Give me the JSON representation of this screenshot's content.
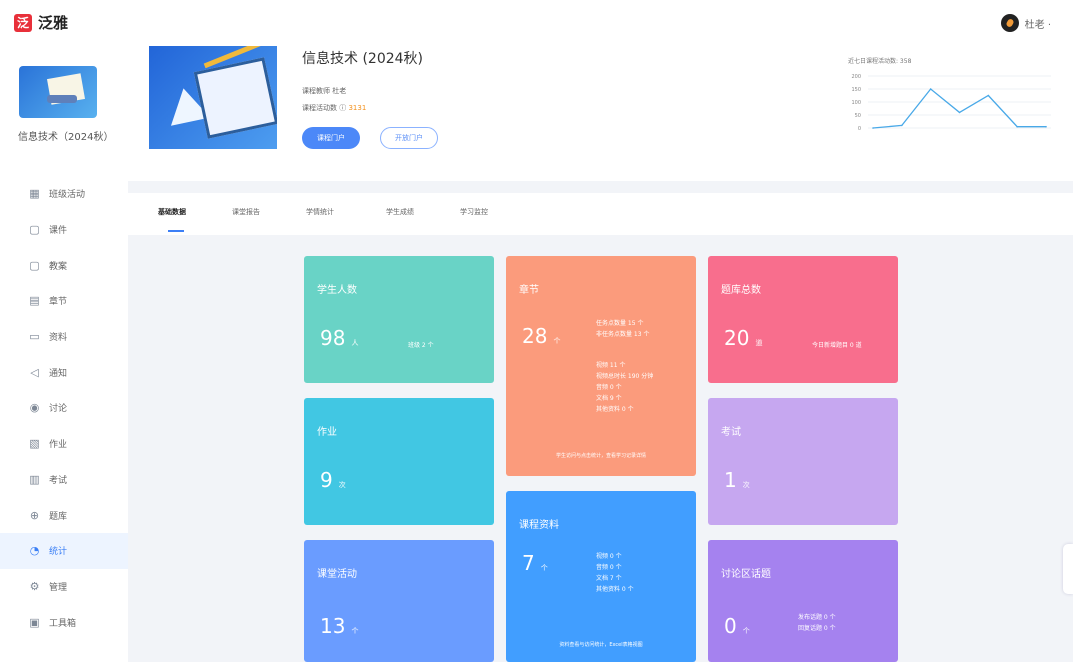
{
  "app": {
    "logo_mark": "泛",
    "logo_text": "泛雅",
    "user_name": "杜老 ·"
  },
  "sidebar": {
    "course_title": "信息技术（2024秋）",
    "items": [
      {
        "label": "班级活动",
        "icon": "grid-icon",
        "glyph": "▦"
      },
      {
        "label": "课件",
        "icon": "document-icon",
        "glyph": "▢"
      },
      {
        "label": "教案",
        "icon": "file-icon",
        "glyph": "▢"
      },
      {
        "label": "章节",
        "icon": "chapter-icon",
        "glyph": "▤"
      },
      {
        "label": "资料",
        "icon": "folder-icon",
        "glyph": "▭"
      },
      {
        "label": "通知",
        "icon": "megaphone-icon",
        "glyph": "◁"
      },
      {
        "label": "讨论",
        "icon": "discussion-icon",
        "glyph": "◉"
      },
      {
        "label": "作业",
        "icon": "homework-icon",
        "glyph": "▧"
      },
      {
        "label": "考试",
        "icon": "exam-icon",
        "glyph": "▥"
      },
      {
        "label": "题库",
        "icon": "question-bank-icon",
        "glyph": "⊕"
      },
      {
        "label": "统计",
        "icon": "statistics-icon",
        "glyph": "◔",
        "active": true
      },
      {
        "label": "管理",
        "icon": "settings-icon",
        "glyph": "⚙"
      },
      {
        "label": "工具箱",
        "icon": "toolbox-icon",
        "glyph": "▣"
      }
    ]
  },
  "course": {
    "title": "信息技术 (2024秋)",
    "teacher_label": "课程教师",
    "teacher": "杜老",
    "activity_label": "课程活动数",
    "activity_value": "3131",
    "primary_button": "课程门户",
    "secondary_button": "开放门户"
  },
  "mini_chart": {
    "caption": "近七日课程活动数: 358",
    "color": "#49a9e8",
    "y_ticks": [
      "200",
      "150",
      "100",
      "50",
      "0"
    ],
    "values": [
      0,
      10,
      150,
      60,
      125,
      5,
      5
    ]
  },
  "tabs": [
    "基础数据",
    "课堂报告",
    "学情统计",
    "学生成绩",
    "学习监控"
  ],
  "cards": {
    "students": {
      "title": "学生人数",
      "value": "98",
      "unit": "人",
      "extra": "班级 2 个"
    },
    "chapter": {
      "title": "章节",
      "value": "28",
      "unit": "个",
      "lines_top": [
        "任务点数量 15 个",
        "非任务点数量 13 个"
      ],
      "lines_bottom": [
        "视频 11 个",
        "视频总时长 190 分钟",
        "音频 0 个",
        "文档 9 个",
        "其他资料 0 个"
      ],
      "note": "学生访问与点击统计，查看学习记录详情"
    },
    "bank": {
      "title": "题库总数",
      "value": "20",
      "unit": "道",
      "extra": "今日新增题目 0 道"
    },
    "homework": {
      "title": "作业",
      "value": "9",
      "unit": "次"
    },
    "exam": {
      "title": "考试",
      "value": "1",
      "unit": "次"
    },
    "material": {
      "title": "课程资料",
      "value": "7",
      "unit": "个",
      "lines": [
        "视频 0 个",
        "音频 0 个",
        "文档 7 个",
        "其他资料 0 个"
      ],
      "note": "资料查看与访问统计，Excel表格视图"
    },
    "activity": {
      "title": "课堂活动",
      "value": "13",
      "unit": "个"
    },
    "discussion": {
      "title": "讨论区话题",
      "value": "0",
      "unit": "个",
      "lines": [
        "发布话题 0 个",
        "回复话题 0 个"
      ]
    }
  }
}
